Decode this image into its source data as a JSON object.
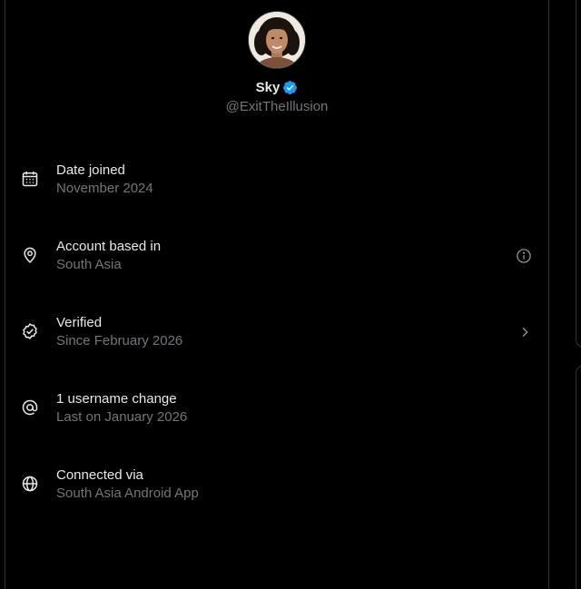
{
  "profile": {
    "display_name": "Sky",
    "handle": "@ExitTheIllusion",
    "avatar_alt": "profile photo"
  },
  "info_rows": [
    {
      "icon": "calendar-icon",
      "title": "Date joined",
      "subtitle": "November 2024"
    },
    {
      "icon": "location-pin-icon",
      "title": "Account based in",
      "subtitle": "South Asia"
    },
    {
      "icon": "verified-check-icon",
      "title": "Verified",
      "subtitle": "Since February 2026"
    },
    {
      "icon": "at-sign-icon",
      "title": "1 username change",
      "subtitle": "Last on January 2026"
    },
    {
      "icon": "globe-icon",
      "title": "Connected via",
      "subtitle": "South Asia Android App"
    }
  ],
  "colors": {
    "background": "#000000",
    "primary_text": "#e7e9ea",
    "secondary_text": "#71767b",
    "verified_blue": "#1d9bf0",
    "divider": "#2f3336"
  }
}
